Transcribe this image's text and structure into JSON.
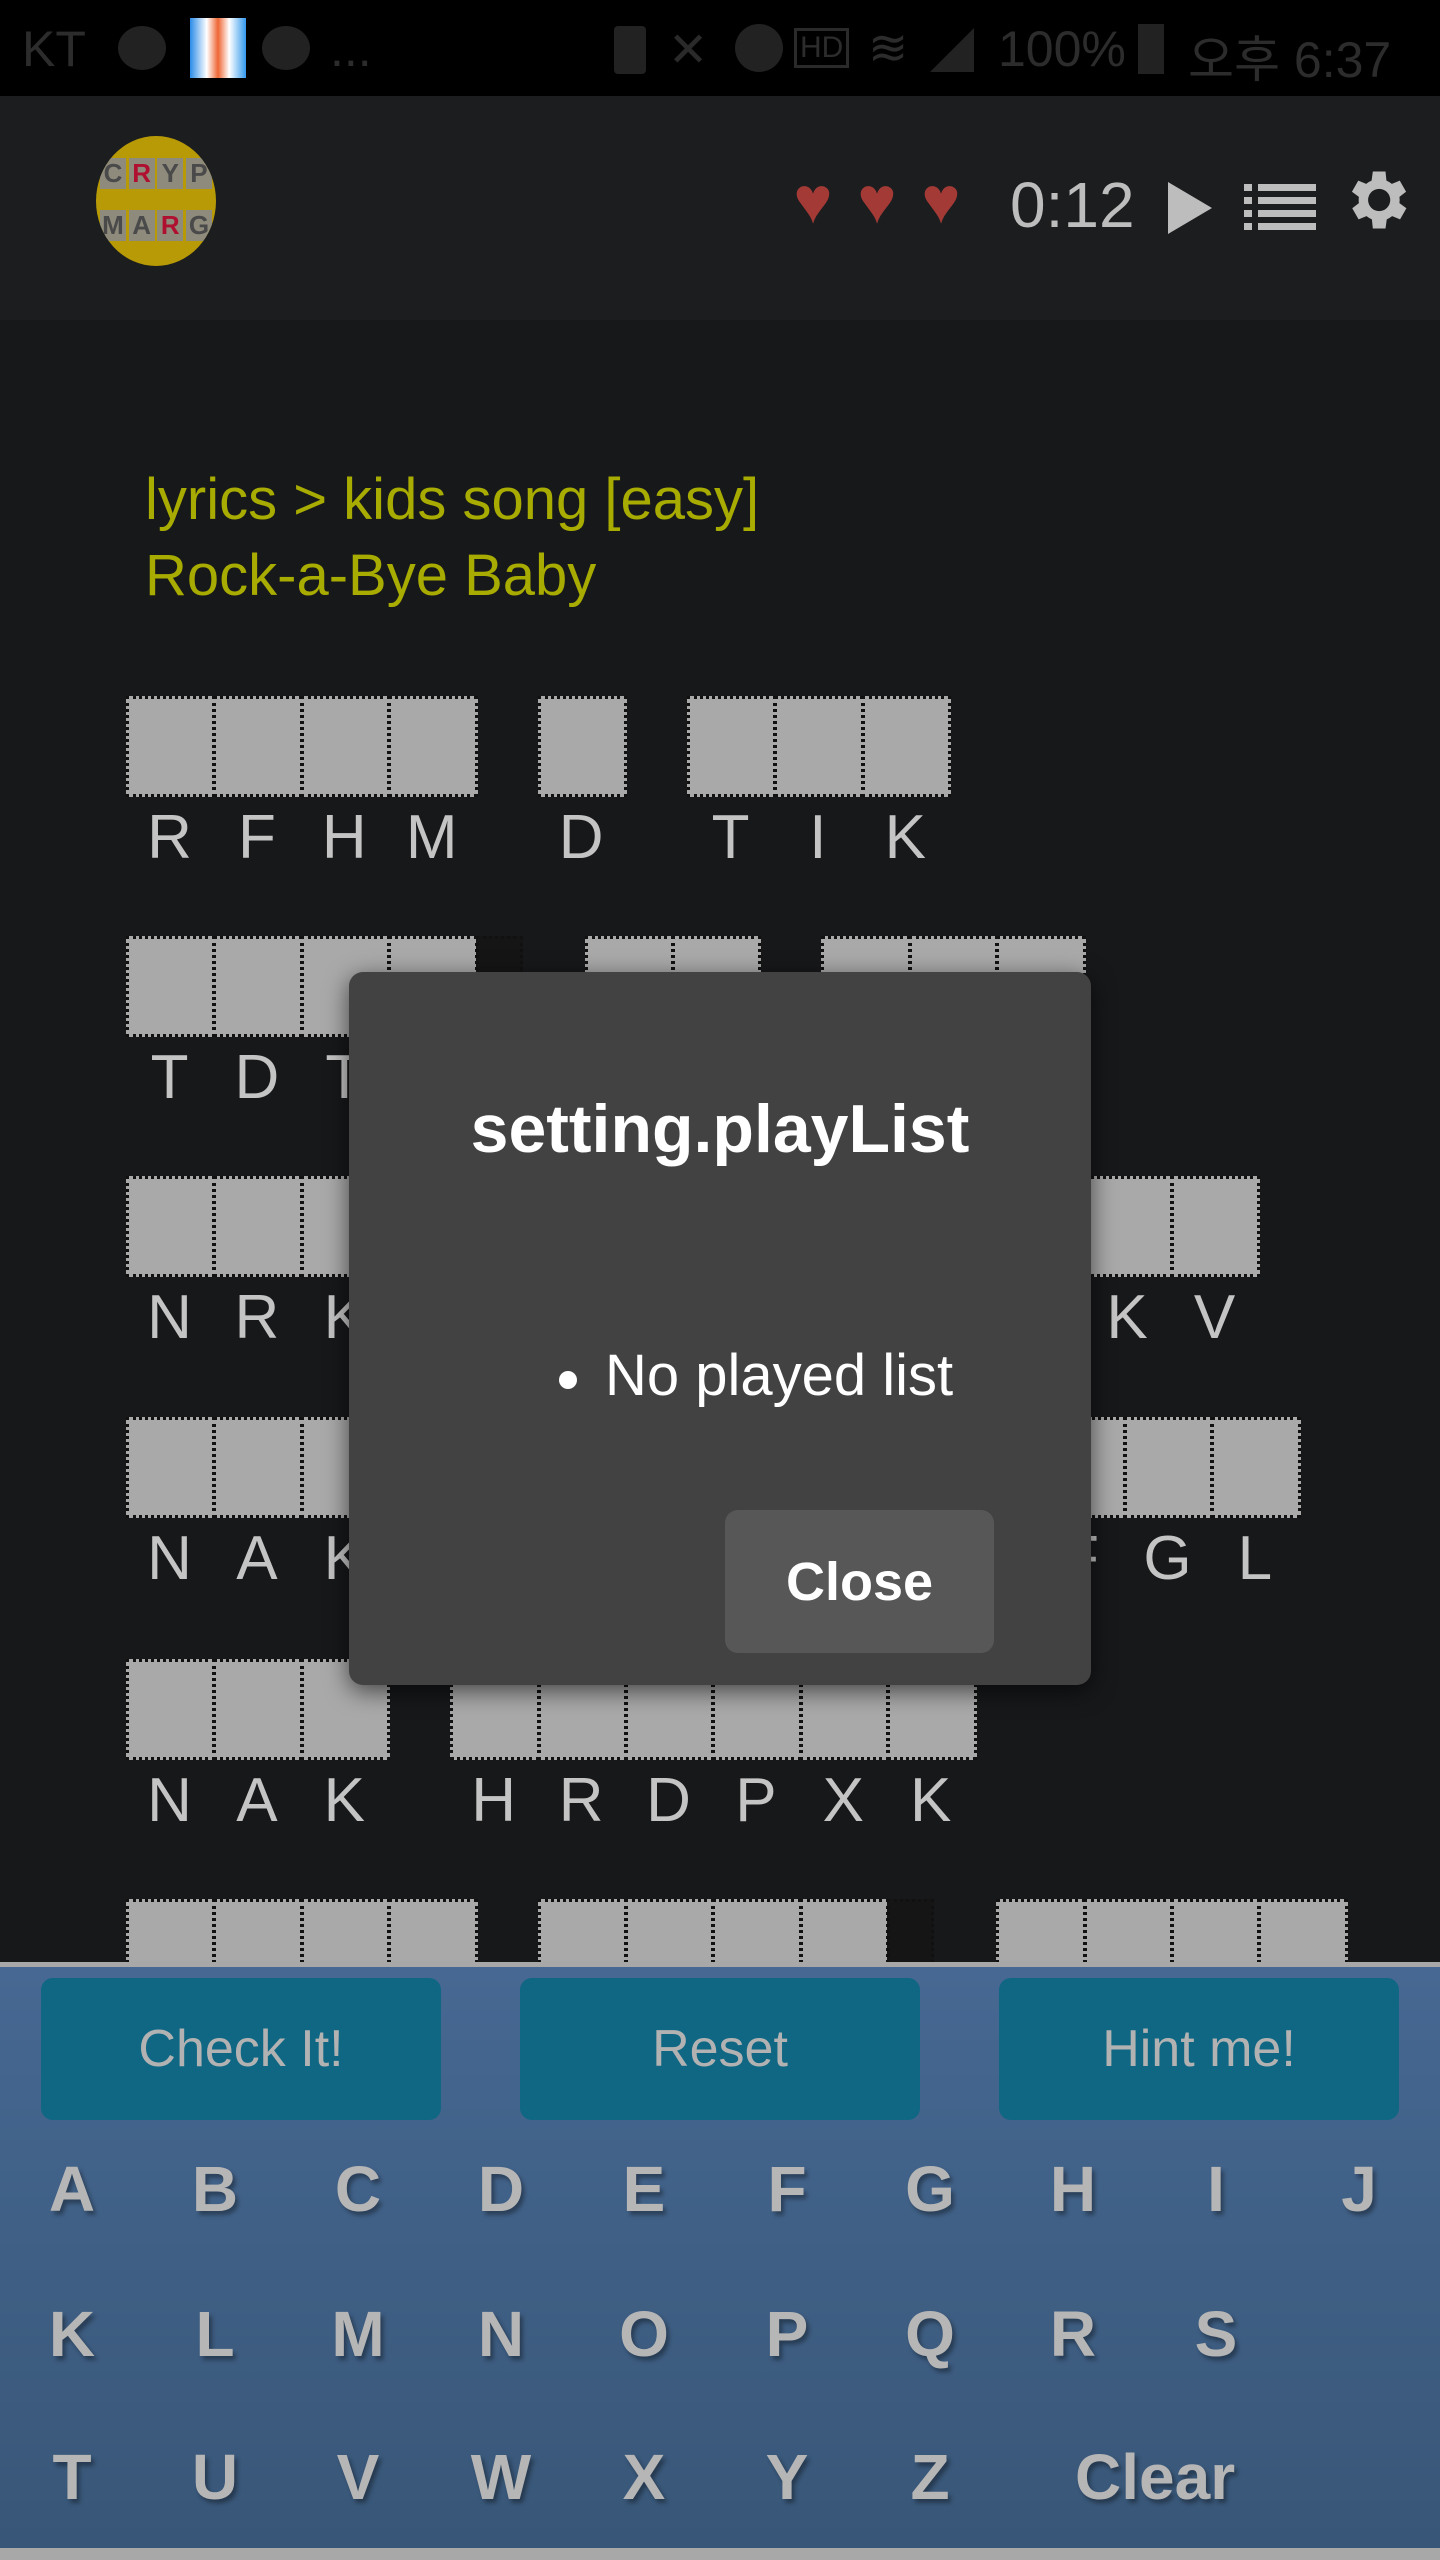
{
  "status_bar": {
    "carrier": "KT",
    "ellipsis": "...",
    "battery": "100%",
    "time": "오후 6:37",
    "icons": [
      "chat-bubble-icon",
      "app-notification-icon",
      "chat-bubble-icon",
      "battery-saver-icon",
      "mute-icon",
      "alarm-icon",
      "hd-voice-icon",
      "wifi-icon",
      "signal-icon",
      "battery-icon"
    ]
  },
  "header": {
    "logo_letters": [
      "C",
      "R",
      "Y",
      "P",
      "M",
      "A",
      "R",
      "G"
    ],
    "lives": 3,
    "timer": "0:12",
    "icons": [
      "heart-icon",
      "play-icon",
      "list-icon",
      "gear-icon"
    ],
    "heart_color": "#a33a36"
  },
  "puzzle": {
    "category": "lyrics > kids song [easy]",
    "title": "Rock-a-Bye Baby",
    "accent_color": "#a8ab00",
    "rows": [
      [
        {
          "letters": [
            "R",
            "F",
            "H",
            "M"
          ]
        },
        {
          "letters": [
            "D"
          ]
        },
        {
          "letters": [
            "T",
            "I",
            "K"
          ]
        }
      ],
      [
        {
          "letters": [
            "T",
            "D",
            "T",
            ""
          ],
          "trailing_blank": true
        },
        {
          "letters": [
            "",
            ""
          ]
        },
        {
          "letters": [
            "",
            "",
            ""
          ]
        }
      ],
      [
        {
          "letters": [
            "N",
            "R",
            "K",
            ""
          ]
        },
        {
          "letters": [
            "",
            "",
            ""
          ],
          "trailing_blank": true
        },
        {
          "letters": [
            "",
            "",
            "K",
            "V"
          ]
        }
      ],
      [
        {
          "letters": [
            "N",
            "A",
            "K"
          ]
        },
        {
          "letters": [
            "",
            "",
            "",
            ""
          ]
        },
        {
          "letters": [
            "",
            "",
            "F",
            "G",
            "L"
          ]
        }
      ],
      [
        {
          "letters": [
            "N",
            "A",
            "K"
          ]
        },
        {
          "letters": [
            "H",
            "R",
            "D",
            "P",
            "X",
            "K"
          ]
        }
      ],
      [
        {
          "letters": [
            "",
            "",
            "",
            ""
          ]
        },
        {
          "letters": [
            "",
            "",
            "",
            ""
          ],
          "trailing_blank": true
        },
        {
          "letters": [
            "",
            "",
            "",
            ""
          ]
        }
      ]
    ]
  },
  "dialog": {
    "title": "setting.playList",
    "items": [
      "No played list"
    ],
    "close_label": "Close"
  },
  "keyboard": {
    "actions": [
      "Check It!",
      "Reset",
      "Hint me!"
    ],
    "rows": [
      [
        "A",
        "B",
        "C",
        "D",
        "E",
        "F",
        "G",
        "H",
        "I",
        "J"
      ],
      [
        "K",
        "L",
        "M",
        "N",
        "O",
        "P",
        "Q",
        "R",
        "S"
      ],
      [
        "T",
        "U",
        "V",
        "W",
        "X",
        "Y",
        "Z"
      ]
    ],
    "clear_label": "Clear",
    "button_color": "#0f6784"
  }
}
